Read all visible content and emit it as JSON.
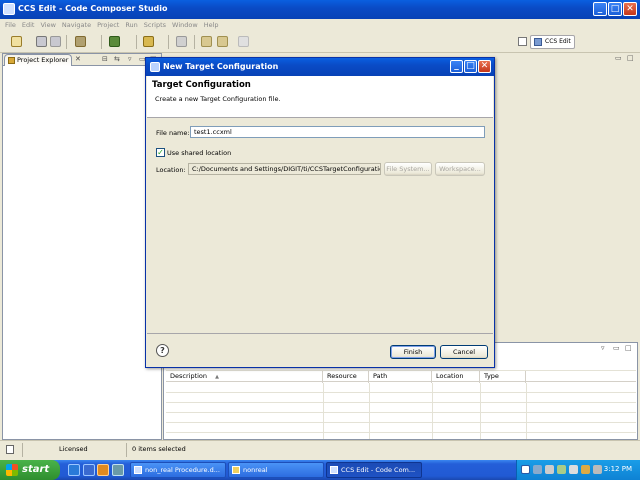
{
  "window": {
    "title": "CCS Edit - Code Composer Studio",
    "min": "_",
    "max": "□",
    "close": "✕"
  },
  "menu": [
    "File",
    "Edit",
    "View",
    "Navigate",
    "Project",
    "Run",
    "Scripts",
    "Window",
    "Help"
  ],
  "perspective": {
    "label": "CCS Edit"
  },
  "explorer": {
    "tab_label": "Project Explorer",
    "close": "✕",
    "collapse": "⊟",
    "link": "⇆",
    "menu": "▿",
    "minimize": "▭",
    "maximize": "□"
  },
  "editor": {
    "minimize": "▭",
    "maximize": "□"
  },
  "problems": {
    "columns": [
      "Description",
      "Resource",
      "Path",
      "Location",
      "Type"
    ],
    "sort_indicator": "▲",
    "menu": "▿",
    "minimize": "▭",
    "maximize": "□"
  },
  "statusbar": {
    "license": "Licensed",
    "items": "0 items selected"
  },
  "dialog": {
    "title": "New Target Configuration",
    "min": "_",
    "max": "□",
    "close": "✕",
    "header": "Target Configuration",
    "subheader": "Create a new Target Configuration file.",
    "file_name_label": "File name:",
    "file_name_value": "test1.ccxml",
    "use_shared_label": "Use shared location",
    "use_shared_checked": true,
    "check_mark": "✓",
    "location_label": "Location:",
    "location_value": "C:/Documents and Settings/DIGIT/ti/CCSTargetConfigurations",
    "file_system_button": "File System...",
    "workspace_button": "Workspace...",
    "help": "?",
    "finish_button": "Finish",
    "cancel_button": "Cancel"
  },
  "taskbar": {
    "start": "start",
    "tasks": [
      "non_real Procedure.d...",
      "nonreal",
      "CCS Edit - Code Com..."
    ],
    "clock": "3:12 PM"
  }
}
